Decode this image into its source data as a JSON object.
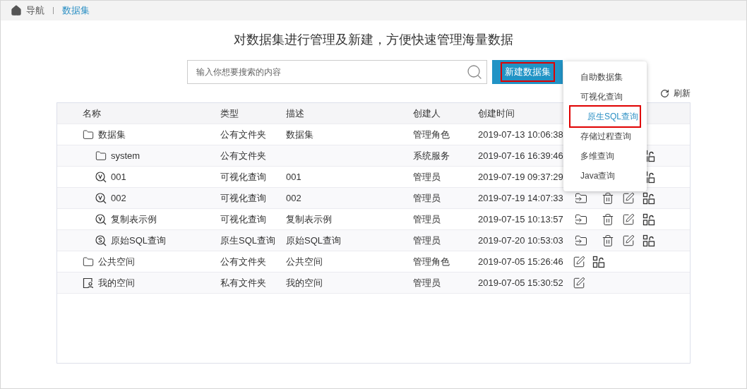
{
  "breadcrumb": [
    {
      "label": "导航",
      "selected": false
    },
    {
      "label": "数据集",
      "selected": true
    }
  ],
  "heading": "对数据集进行管理及新建，方便快速管理海量数据",
  "search": {
    "placeholder": "输入你想要搜索的内容"
  },
  "new_button": {
    "label": "新建数据集",
    "highlighted": true
  },
  "menu": [
    {
      "label": "自助数据集",
      "selected": false
    },
    {
      "label": "可视化查询",
      "selected": false
    },
    {
      "label": "原生SQL查询",
      "selected": true
    },
    {
      "label": "存储过程查询",
      "selected": false
    },
    {
      "label": "多维查询",
      "selected": false
    },
    {
      "label": "Java查询",
      "selected": false
    }
  ],
  "refresh": "刷新",
  "table": {
    "columns": [
      "名称",
      "类型",
      "描述",
      "创建人",
      "创建时间"
    ],
    "rows": [
      {
        "kind": "folder",
        "name": "数据集",
        "type": "公有文件夹",
        "description": "数据集",
        "creator": "管理角色",
        "created": "2019-07-13 10:06:38",
        "children": [
          {
            "kind": "folder",
            "name": "system",
            "type": "公有文件夹",
            "creator": "系统服务",
            "created": "2019-07-16 16:39:46",
            "actions": [
              {
                "kind": "permission"
              }
            ]
          },
          {
            "kind": "visual",
            "name": "001",
            "type": "可视化查询",
            "description": "001",
            "creator": "管理员",
            "created": "2019-07-19 09:37:29",
            "actions": [
              {
                "kind": "permission"
              }
            ]
          },
          {
            "kind": "visual",
            "name": "002",
            "type": "可视化查询",
            "description": "002",
            "creator": "管理员",
            "created": "2019-07-19 14:07:33",
            "actions": [
              {
                "kind": "move"
              },
              {
                "kind": "delete"
              },
              {
                "kind": "edit"
              },
              {
                "kind": "permission"
              }
            ]
          },
          {
            "kind": "visual",
            "name": "复制表示例",
            "type": "可视化查询",
            "description": "复制表示例",
            "creator": "管理员",
            "created": "2019-07-15 10:13:57",
            "actions": [
              {
                "kind": "move"
              },
              {
                "kind": "delete"
              },
              {
                "kind": "edit"
              },
              {
                "kind": "permission"
              }
            ]
          },
          {
            "kind": "sql",
            "name": "原始SQL查询",
            "type": "原生SQL查询",
            "description": "原始SQL查询",
            "creator": "管理员",
            "created": "2019-07-20 10:53:03",
            "actions": [
              {
                "kind": "move"
              },
              {
                "kind": "delete"
              },
              {
                "kind": "edit"
              },
              {
                "kind": "permission"
              }
            ]
          }
        ]
      },
      {
        "kind": "folder",
        "name": "公共空间",
        "type": "公有文件夹",
        "description": "公共空间",
        "creator": "管理角色",
        "created": "2019-07-05 15:26:46",
        "actions": [
          {
            "kind": "edit"
          },
          {
            "kind": "permission"
          }
        ]
      },
      {
        "kind": "personal",
        "name": "我的空间",
        "type": "私有文件夹",
        "description": "我的空间",
        "creator": "管理员",
        "created": "2019-07-05 15:30:52",
        "actions": [
          {
            "kind": "edit"
          }
        ]
      }
    ]
  }
}
